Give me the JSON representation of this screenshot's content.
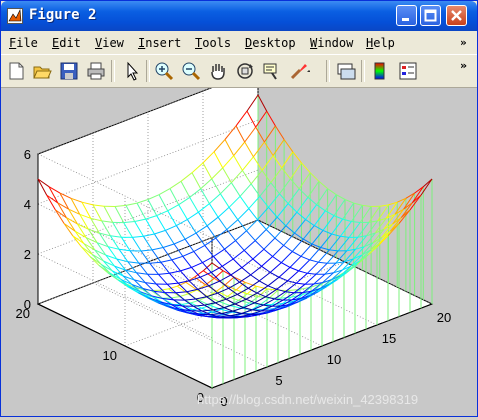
{
  "window": {
    "title": "Figure 2"
  },
  "menu": {
    "items": [
      {
        "u": "F",
        "rest": "ile"
      },
      {
        "u": "E",
        "rest": "dit"
      },
      {
        "u": "V",
        "rest": "iew"
      },
      {
        "u": "I",
        "rest": "nsert"
      },
      {
        "u": "T",
        "rest": "ools"
      },
      {
        "u": "D",
        "rest": "esktop"
      },
      {
        "u": "W",
        "rest": "indow"
      },
      {
        "u": "H",
        "rest": "elp"
      }
    ],
    "overflow": "»"
  },
  "toolbar": {
    "tools": [
      "new-figure-icon",
      "open-file-icon",
      "save-icon",
      "print-icon",
      "edit-plot-arrow-icon",
      "zoom-in-icon",
      "zoom-out-icon",
      "pan-hand-icon",
      "rotate-3d-icon",
      "data-cursor-icon",
      "brush-icon",
      "link-plot-icon",
      "colorbar-icon",
      "legend-icon"
    ],
    "overflow": "»"
  },
  "chart_data": {
    "type": "surface-mesh",
    "xlim": [
      0,
      20
    ],
    "ylim": [
      0,
      20
    ],
    "zlim": [
      0,
      6
    ],
    "x_ticks": [
      "0",
      "5",
      "10",
      "15",
      "20"
    ],
    "y_ticks": [
      "0",
      "10",
      "20"
    ],
    "z_ticks": [
      "0",
      "2",
      "4",
      "6"
    ],
    "grid": true,
    "colormap": "jet (cyan to red)"
  },
  "watermark": "https://blog.csdn.net/weixin_42398319",
  "colors": {
    "title_bar": "#0550d8",
    "figure_bg": "#c8c8c8",
    "axes_bg": "#ffffff",
    "stem": "#7cf07c"
  }
}
